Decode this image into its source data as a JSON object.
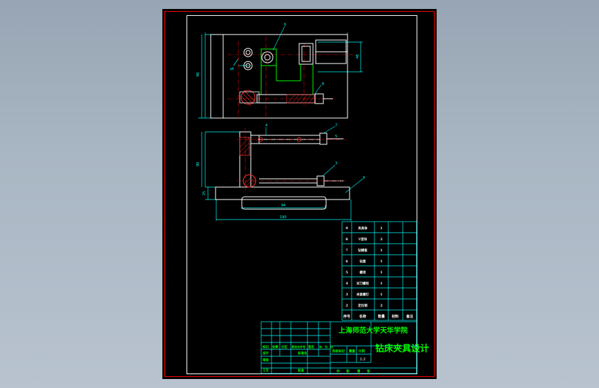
{
  "colors": {
    "border": "#ff0000",
    "centerline": "#ff0000",
    "part": "#ffffff",
    "dimension": "#00ffff",
    "hatch": "#ff3333",
    "highlight": "#00ff00",
    "title_text": "#00ff00",
    "table_text": "#ffffff"
  },
  "title_block": {
    "school": "上海师范大学天华学院",
    "drawing_title": "钻床夹具设计",
    "scale": "1:2",
    "row_labels": [
      "标记",
      "处数",
      "分区",
      "更改文件号",
      "签名",
      "年、月、日"
    ],
    "row2_labels": [
      "设计",
      "标准化"
    ],
    "row3_labels": [
      "审核"
    ],
    "row4_labels": [
      "工艺",
      "批准"
    ],
    "stage_headers": [
      "阶段标记",
      "重量",
      "比例"
    ],
    "footer_labels": [
      "共",
      "张",
      "第",
      "张"
    ]
  },
  "parts_list": {
    "rows": [
      {
        "no": "9",
        "name": "夹具体",
        "qty": "1"
      },
      {
        "no": "8",
        "name": "V型块",
        "qty": "2"
      },
      {
        "no": "7",
        "name": "钻模板",
        "qty": "1"
      },
      {
        "no": "6",
        "name": "钻套",
        "qty": "1"
      },
      {
        "no": "5",
        "name": "螺母",
        "qty": "1"
      },
      {
        "no": "4",
        "name": "对刀螺栓",
        "qty": "1"
      },
      {
        "no": "3",
        "name": "夹紧螺钉",
        "qty": "1"
      },
      {
        "no": "2",
        "name": "定位销",
        "qty": "2"
      }
    ],
    "header": {
      "no": "序号",
      "name": "名称",
      "qty": "数量",
      "material": "材料",
      "note": "备注"
    }
  },
  "dimensions": {
    "top_view_height": "96",
    "top_view_right": "48",
    "front_view_height": "90",
    "front_view_bottom": "25",
    "base_inner_width": "94",
    "base_total_width": "190"
  },
  "balloons": [
    "6",
    "8",
    "4",
    "7",
    "5",
    "3",
    "9"
  ]
}
